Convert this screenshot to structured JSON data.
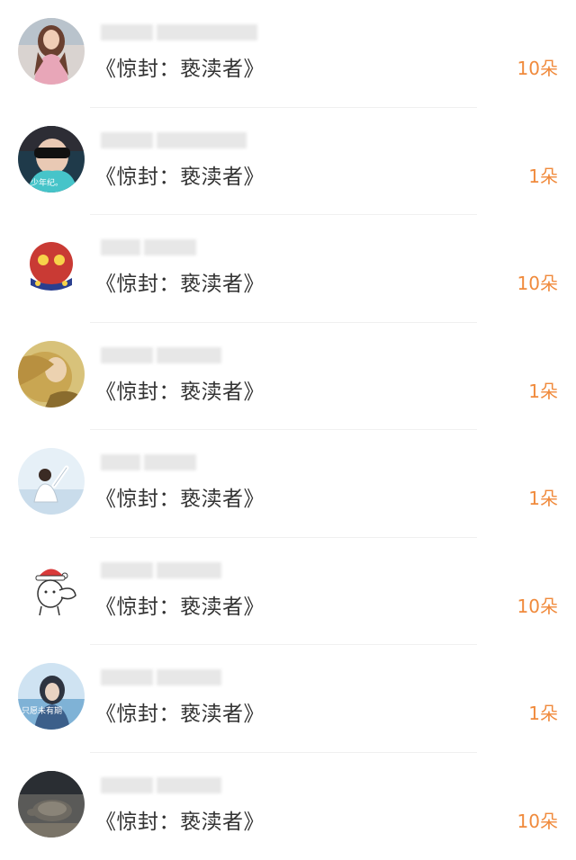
{
  "rows": [
    {
      "title": "《惊封：亵渎者》",
      "count": "10朵",
      "avatar": "avatar-girl-pink-dress"
    },
    {
      "title": "《惊封：亵渎者》",
      "count": "1朵",
      "avatar": "avatar-sunglasses",
      "avatar_caption": "少年纪。"
    },
    {
      "title": "《惊封：亵渎者》",
      "count": "10朵",
      "avatar": "avatar-red-cartoon"
    },
    {
      "title": "《惊封：亵渎者》",
      "count": "1朵",
      "avatar": "avatar-blonde-hair"
    },
    {
      "title": "《惊封：亵渎者》",
      "count": "1朵",
      "avatar": "avatar-waving-boy"
    },
    {
      "title": "《惊封：亵渎者》",
      "count": "10朵",
      "avatar": "avatar-santa-bunny"
    },
    {
      "title": "《惊封：亵渎者》",
      "count": "1朵",
      "avatar": "avatar-girl-blue",
      "avatar_caption": "只愿未有期"
    },
    {
      "title": "《惊封：亵渎者》",
      "count": "10朵",
      "avatar": "avatar-turtle-beach"
    }
  ],
  "colors": {
    "count": "#f08a3c",
    "title": "#333333",
    "placeholder": "#e7e7e7"
  }
}
